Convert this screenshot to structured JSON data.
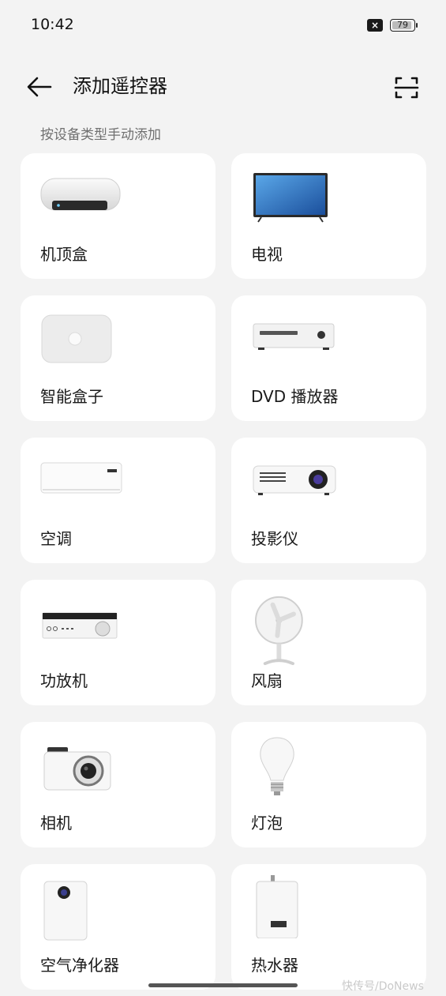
{
  "status": {
    "time": "10:42",
    "battery": "79",
    "notification_icon": "close-notification-icon"
  },
  "header": {
    "title": "添加遥控器",
    "back_icon": "arrow-left-icon",
    "scan_icon": "scan-icon"
  },
  "section_label": "按设备类型手动添加",
  "devices": [
    {
      "label": "机顶盒",
      "icon": "set-top-box-icon"
    },
    {
      "label": "电视",
      "icon": "tv-icon"
    },
    {
      "label": "智能盒子",
      "icon": "smart-box-icon"
    },
    {
      "label": "DVD 播放器",
      "icon": "dvd-player-icon"
    },
    {
      "label": "空调",
      "icon": "air-conditioner-icon"
    },
    {
      "label": "投影仪",
      "icon": "projector-icon"
    },
    {
      "label": "功放机",
      "icon": "amplifier-icon"
    },
    {
      "label": "风扇",
      "icon": "fan-icon"
    },
    {
      "label": "相机",
      "icon": "camera-icon"
    },
    {
      "label": "灯泡",
      "icon": "light-bulb-icon"
    },
    {
      "label": "空气净化器",
      "icon": "air-purifier-icon"
    },
    {
      "label": "热水器",
      "icon": "water-heater-icon"
    }
  ],
  "watermark": "快传号/DoNews",
  "colors": {
    "background": "#f3f3f3",
    "card": "#ffffff",
    "text": "#1a1a1a",
    "secondary_text": "#707070"
  }
}
